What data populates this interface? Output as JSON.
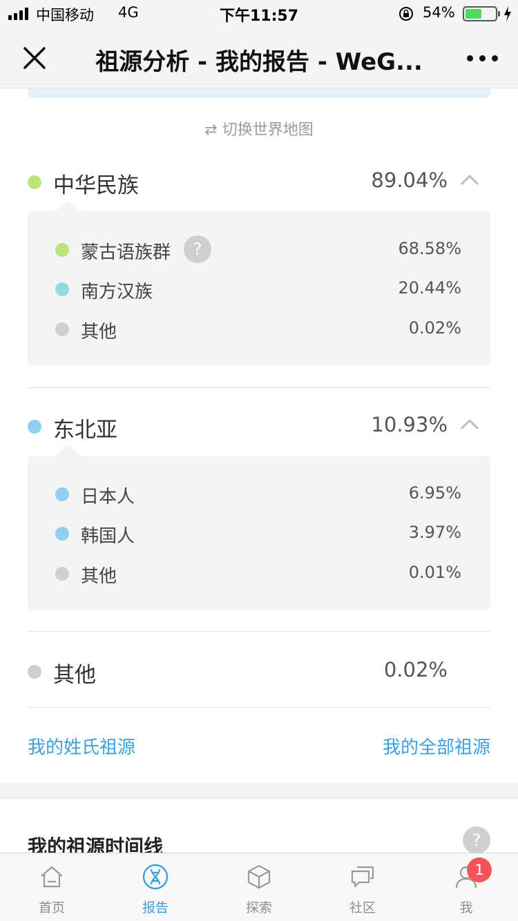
{
  "status_bar": {
    "carrier": "中国移动",
    "network": "4G",
    "time": "下午11:57",
    "battery_percent": "54%",
    "battery_level": 0.54
  },
  "nav": {
    "title": "祖源分析 - 我的报告 - WeG..."
  },
  "switch_map_label": "⇄ 切换世界地图",
  "groups": [
    {
      "name": "中华民族",
      "percent": "89.04%",
      "color": "#b9e47e",
      "subgroups": [
        {
          "name": "蒙古语族群",
          "percent": "68.58%",
          "color": "#b9e47e",
          "help": "?"
        },
        {
          "name": "南方汉族",
          "percent": "20.44%",
          "color": "#8fdde0"
        },
        {
          "name": "其他",
          "percent": "0.02%",
          "color": "#cfcfcf"
        }
      ]
    },
    {
      "name": "东北亚",
      "percent": "10.93%",
      "color": "#92cdf2",
      "subgroups": [
        {
          "name": "日本人",
          "percent": "6.95%",
          "color": "#92cdf2"
        },
        {
          "name": "韩国人",
          "percent": "3.97%",
          "color": "#92cdf2"
        },
        {
          "name": "其他",
          "percent": "0.01%",
          "color": "#cfcfcf"
        }
      ]
    },
    {
      "name": "其他",
      "percent": "0.02%",
      "color": "#cfcfcf"
    }
  ],
  "links": {
    "surname_origin": "我的姓氏祖源",
    "all_origin": "我的全部祖源"
  },
  "timeline": {
    "title": "我的祖源时间线",
    "help": "?"
  },
  "tabs": [
    {
      "label": "首页",
      "icon": "home-icon"
    },
    {
      "label": "报告",
      "icon": "dna-icon",
      "active": true
    },
    {
      "label": "探索",
      "icon": "cube-icon"
    },
    {
      "label": "社区",
      "icon": "chat-icon"
    },
    {
      "label": "我",
      "icon": "person-icon",
      "badge": "1"
    }
  ],
  "colors": {
    "accent": "#3aa0e0",
    "badge": "#f5525a",
    "battery": "#4cd964"
  }
}
